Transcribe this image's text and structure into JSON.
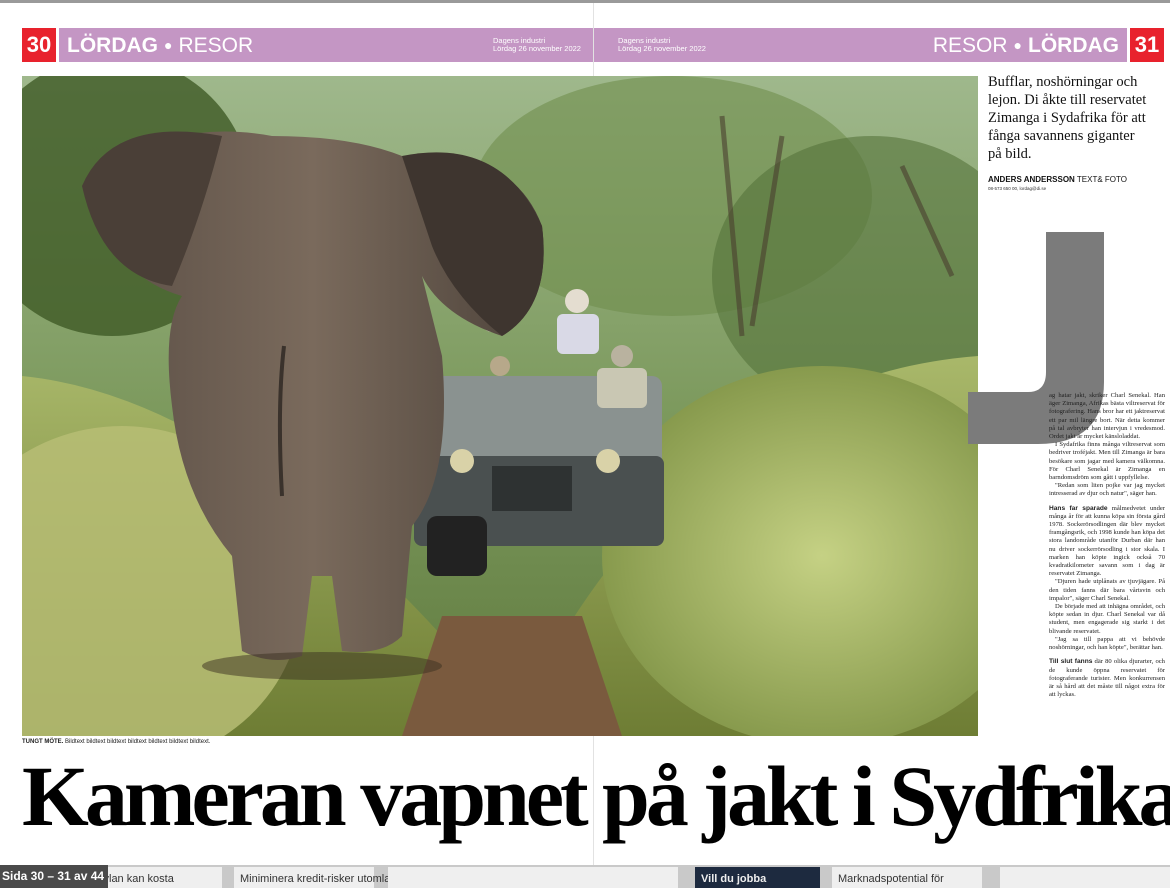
{
  "header": {
    "left_page_number": "30",
    "right_page_number": "31",
    "day": "LÖRDAG",
    "section": "RESOR",
    "publication": "Dagens industri",
    "date": "Lördag 26 november 2022"
  },
  "photo": {
    "caption_lead": "TUNGT MÖTE.",
    "caption_text": "Bildtext bildtext bildtext bildtext bildtext bildtext bildtext."
  },
  "article": {
    "ingress": "Bufflar, noshörningar och lejon. Di åkte till reservatet Zimanga i Sydafrika för att fånga savannens giganter på bild.",
    "byline_name": "ANDERS ANDERSSON",
    "byline_role": "TEXT& FOTO",
    "byline_contact": "08-573 650 00, lordag@di.se",
    "drop_cap": "J",
    "body": [
      "ag hatar jakt, skriker Charl Senekal. Han äger Zimanga, Afrikas bästa viltreservat för fotografering. Hans bror har ett jaktreservat ett par mil längre bort. När detta kommer på tal avbryter han intervjun i vredesmod. Ordet jakt är mycket känsloladdat.",
      "I Sydafrika finns många viltreservat som bedriver troféjakt. Men till Zimanga är bara besökare som jagar med kamera välkomna. För Charl Senekal är Zimanga en barndomsdröm som gått i uppfyllelse.",
      "\"Redan som liten pojke var jag mycket intresserad av djur och natur\", säger han."
    ],
    "body2_lead": "Hans far sparade",
    "body2": [
      "målmedvetet under många år för att kunna köpa sin första gård 1978. Sockerörsodlingen där blev mycket framgångsrik, och 1998 kunde han köpa det stora landområde utanför Durban där han nu driver sockerrörsodling i stor skala. I marken han köpte ingick också 70 kvadratkilometer savann som i dag är reservatet Zimanga.",
      "\"Djuren hade utplånats av tjuvjägare. På den tiden fanns där bara vårtsvin och impalor\", säger Charl Senekal.",
      "De började med att inhägna området, och köpte sedan in djur. Charl Senekal var då student, men engagerade sig starkt i det blivande reservatet.",
      "\"Jag sa till pappa att vi behövde noshörningar, och han köpte\", berättar han."
    ],
    "body3_lead": "Till slut fanns",
    "body3": "där 80 olika djurarter, och de kunde öppna reservatet för fotograferande turister. Men konkurrensen är så hård att det måste till något extra för att lyckas."
  },
  "headline": {
    "left": "Kameran vapnet",
    "right": "på jakt i Sydfrika"
  },
  "viewer": {
    "page_indicator": "Sida 30 – 31 av 44",
    "thumbnails": [
      "kylan kan kosta",
      "Miniminera kredit-risker utomlands",
      "Vill du jobba",
      "Marknadspotential för"
    ]
  },
  "colors": {
    "header_bar": "#c496c4",
    "page_number_box": "#e8222d"
  }
}
